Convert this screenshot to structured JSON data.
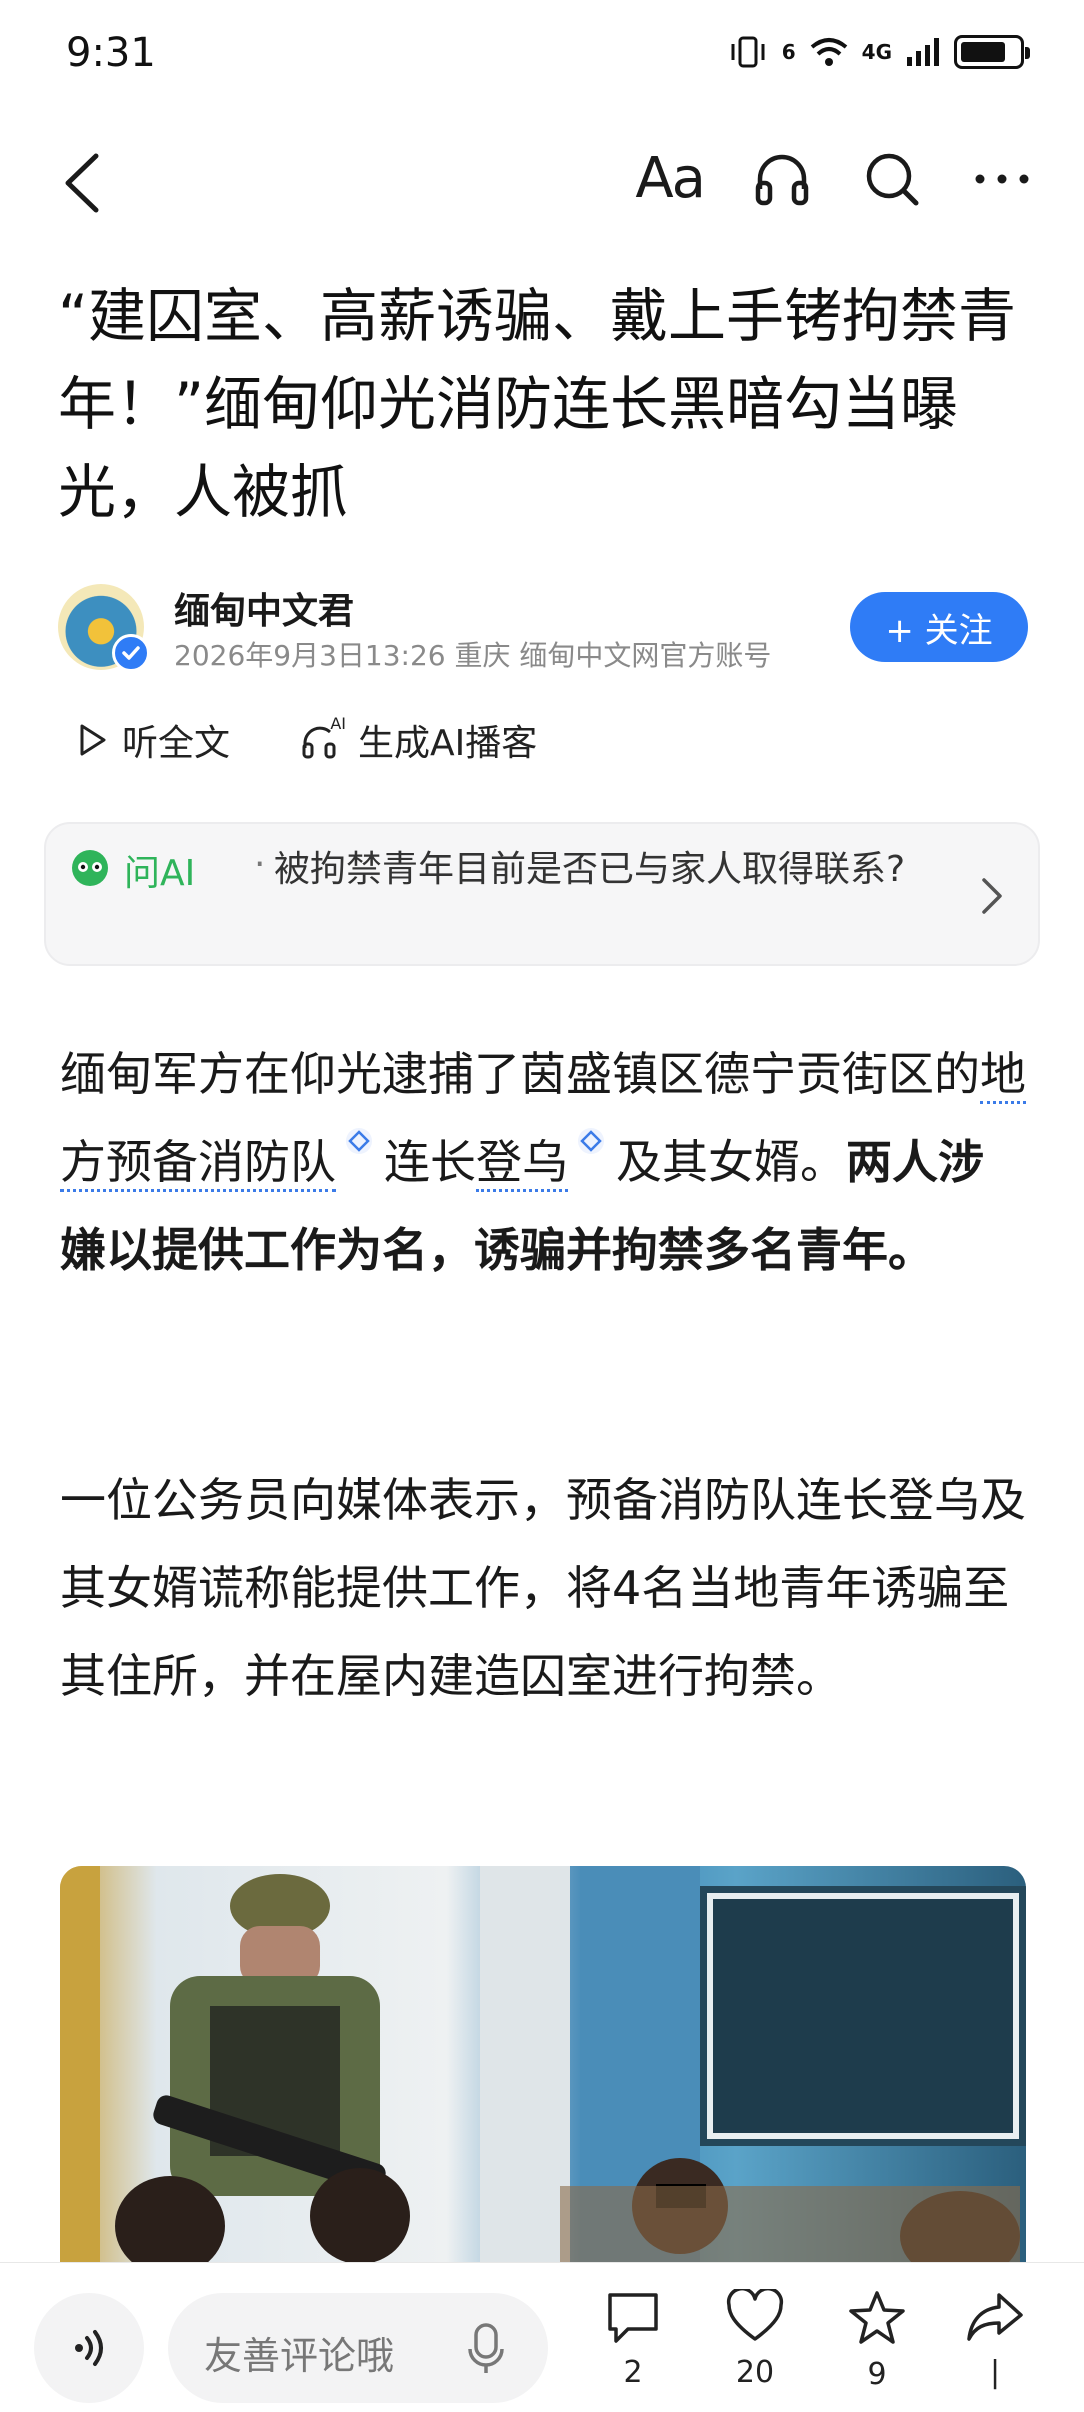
{
  "status_bar": {
    "time": "9:31",
    "signal_label": "4G",
    "wifi_label": "6"
  },
  "nav": {
    "font_label": "Aa"
  },
  "article": {
    "title": "“建囚室、高薪诱骗、戴上手铐拘禁青年！”缅甸仰光消防连长黑暗勾当曝光，人被抓",
    "author": "缅甸中文君",
    "meta": "2026年9月3日13:26 重庆 缅甸中文网官方账号",
    "follow_label": "+ 关注",
    "listen_label": "听全文",
    "podcast_label": "生成AI播客",
    "podcast_badge": "AI"
  },
  "ask_ai": {
    "label": "问AI",
    "dot": "·",
    "question": "被拘禁青年目前是否已与家人取得联系?"
  },
  "body": {
    "p1_a": "缅甸军方在仰光逮捕了茵盛镇区德宁贡街区的",
    "p1_entity1": "地方预备消防队",
    "p1_b": "连长",
    "p1_entity2": "登乌",
    "p1_c": "及其女婿。",
    "p1_bold": "两人涉嫌以提供工作为名，诱骗并拘禁多名青年。",
    "p2": "一位公务员向媒体表示，预备消防队连长登乌及其女婿谎称能提供工作，将4名当地青年诱骗至其住所，并在屋内建造囚室进行拘禁。"
  },
  "bottom_bar": {
    "comment_placeholder": "友善评论哦",
    "comment_count": "2",
    "like_count": "20",
    "star_count": "9",
    "share_count": "|"
  },
  "colors": {
    "accent": "#2f7cf6",
    "ai_green": "#2fb45a",
    "entity_underline": "#3b7be8"
  }
}
